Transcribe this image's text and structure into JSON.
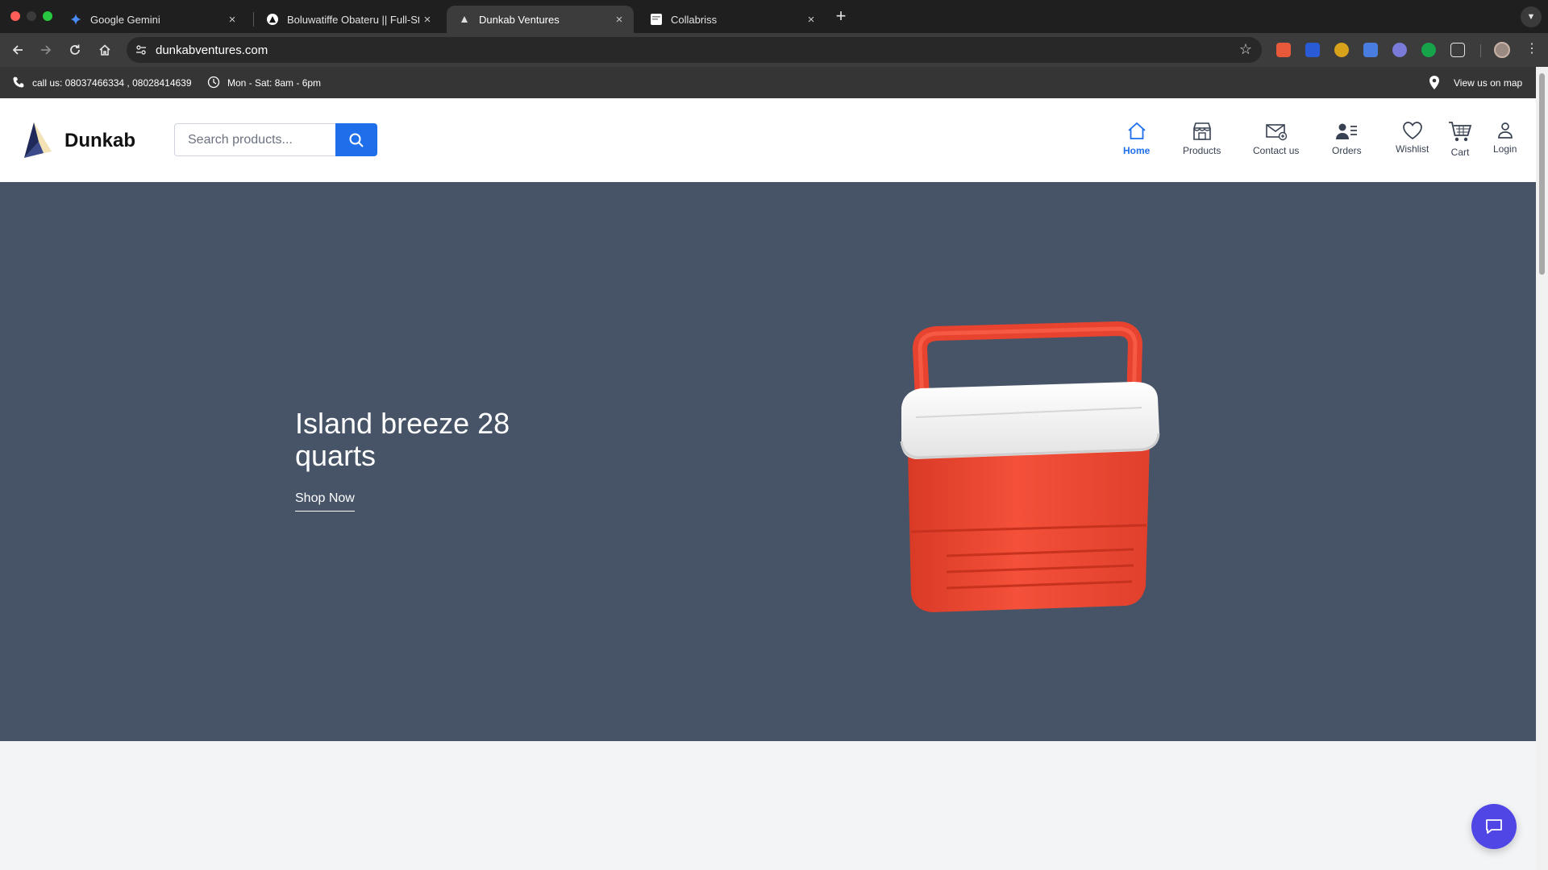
{
  "browser": {
    "tabs": [
      {
        "title": "Google Gemini",
        "favicon": "gemini-icon",
        "active": false
      },
      {
        "title": "Boluwatiffe Obateru || Full-St",
        "favicon": "triangle-logo-icon",
        "active": false
      },
      {
        "title": "Dunkab Ventures",
        "favicon": "dunkab-logo-icon",
        "active": true
      },
      {
        "title": "Collabriss",
        "favicon": "collabriss-icon",
        "active": false
      }
    ],
    "close_glyph": "×",
    "new_tab_glyph": "+",
    "url": "dunkabventures.com"
  },
  "topbar": {
    "call_text": "call us: 08037466334 ,  08028414639",
    "hours_text": "Mon - Sat: 8am - 6pm",
    "map_text": "View us on map"
  },
  "header": {
    "brand": "Dunkab",
    "search_placeholder": "Search products...",
    "nav": [
      {
        "label": "Home",
        "icon": "home-icon",
        "active": true
      },
      {
        "label": "Products",
        "icon": "store-icon",
        "active": false
      },
      {
        "label": "Contact us",
        "icon": "mail-icon",
        "active": false
      },
      {
        "label": "Orders",
        "icon": "orders-icon",
        "active": false
      },
      {
        "label": "Wishlist",
        "icon": "heart-icon",
        "active": false
      },
      {
        "label": "Cart",
        "icon": "cart-icon",
        "active": false
      },
      {
        "label": "Login",
        "icon": "user-icon",
        "active": false
      }
    ]
  },
  "hero": {
    "title": "Island breeze 28 quarts",
    "cta": "Shop Now",
    "image": "red-cooler-image"
  },
  "colors": {
    "accent": "#1f6feb",
    "hero_bg": "#475467",
    "topbar_bg": "#353535",
    "chat_button": "#4f46e5",
    "cooler_red": "#f04a36"
  }
}
